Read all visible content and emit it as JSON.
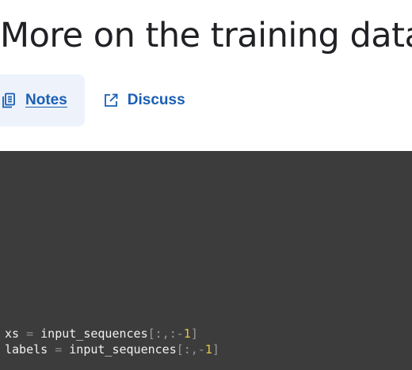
{
  "page": {
    "title": "More on the training data"
  },
  "tabs": [
    {
      "label": "Notes",
      "icon": "notes-icon"
    },
    {
      "label": "Discuss",
      "icon": "external-link-icon"
    }
  ],
  "code": {
    "lines": [
      {
        "var": "xs",
        "op": "=",
        "fn": "input_sequences",
        "open": "[",
        "slice_prefix": ":,:-",
        "num": "1",
        "close": "]"
      },
      {
        "var": "labels",
        "op": "=",
        "fn": "input_sequences",
        "open": "[",
        "slice_prefix": ":,-",
        "num": "1",
        "close": "]"
      }
    ]
  },
  "colors": {
    "link": "#1a5fb4",
    "tab_active_bg": "#eef3fb",
    "code_bg": "#3c3c3c",
    "code_number": "#e8c547"
  }
}
